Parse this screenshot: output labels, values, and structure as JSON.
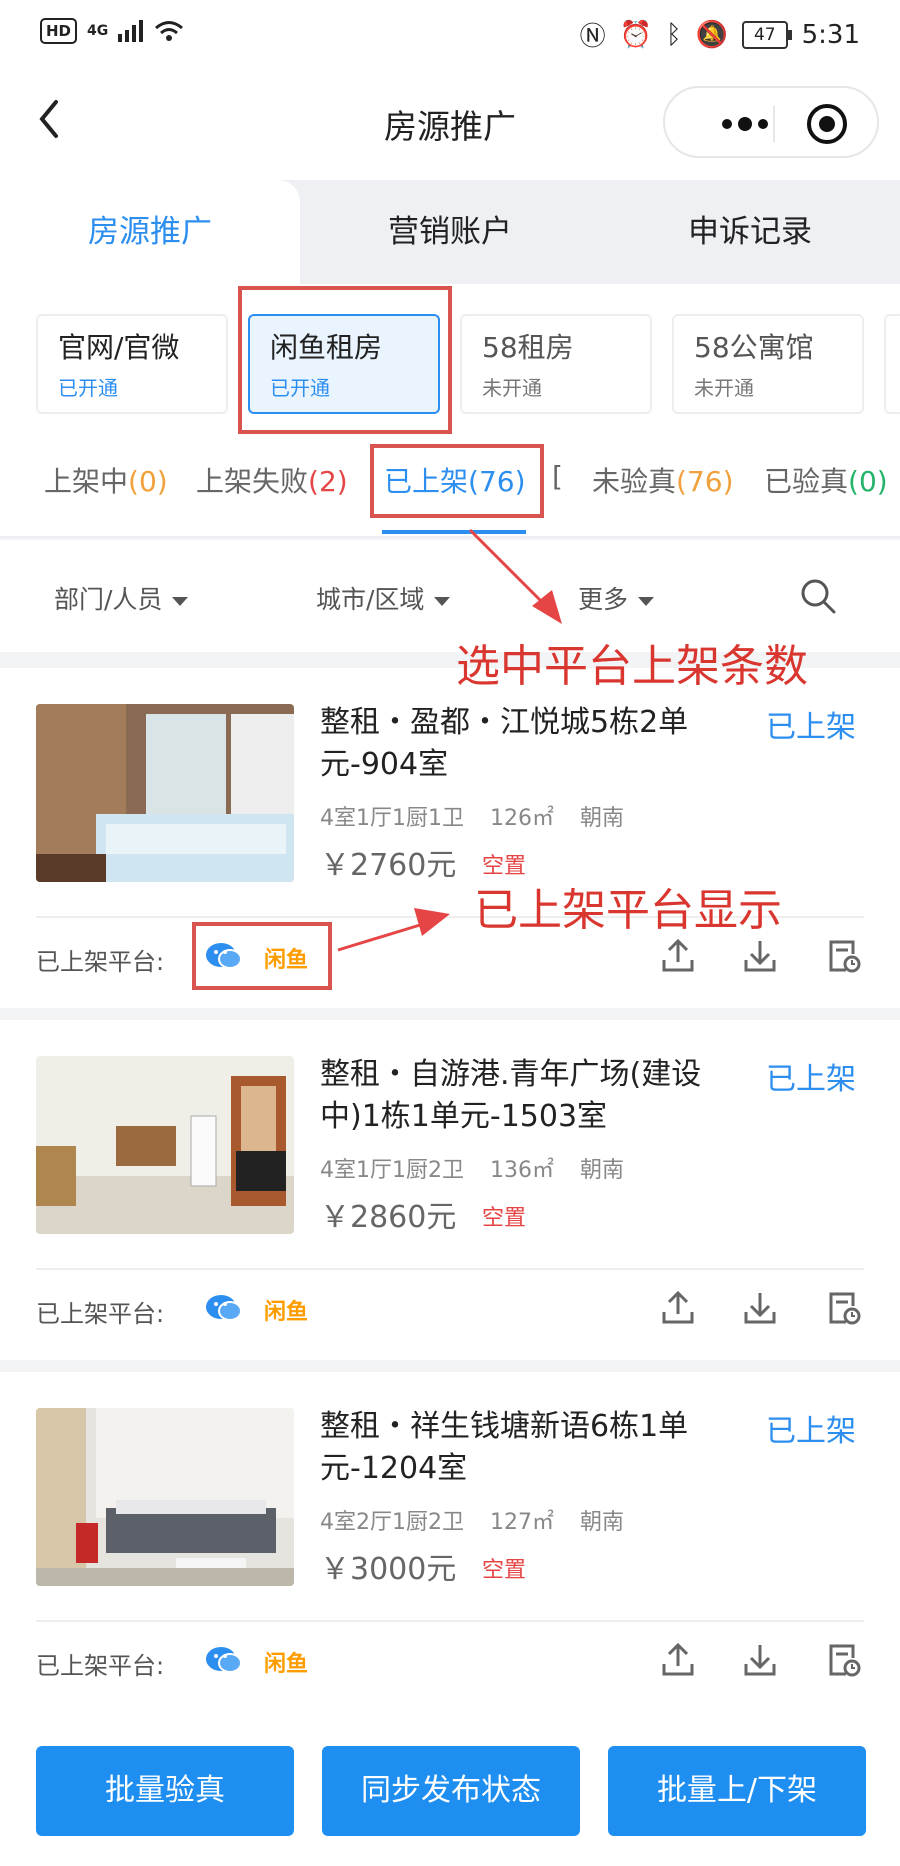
{
  "status_bar": {
    "hd": "HD",
    "network": "4G",
    "battery": "47",
    "time": "5:31"
  },
  "nav": {
    "title": "房源推广"
  },
  "top_tabs": [
    {
      "label": "房源推广",
      "active": true
    },
    {
      "label": "营销账户",
      "active": false
    },
    {
      "label": "申诉记录",
      "active": false
    }
  ],
  "platforms": [
    {
      "name": "官网/官微",
      "status": "已开通"
    },
    {
      "name": "闲鱼租房",
      "status": "已开通"
    },
    {
      "name": "58租房",
      "status": "未开通"
    },
    {
      "name": "58公寓馆",
      "status": "未开通"
    }
  ],
  "status_tabs": [
    {
      "label": "上架中",
      "count": "(0)"
    },
    {
      "label": "上架失败",
      "count": "(2)"
    },
    {
      "label": "已上架",
      "count": "(76)"
    },
    {
      "label": "[",
      "count": ""
    },
    {
      "label": "未验真",
      "count": "(76)"
    },
    {
      "label": "已验真",
      "count": "(0)"
    }
  ],
  "filters": {
    "dept": "部门/人员",
    "city": "城市/区域",
    "more": "更多"
  },
  "listings": [
    {
      "title": "整租・盈都・江悦城5栋2单元-904室",
      "status": "已上架",
      "rooms": "4室1厅1厨1卫",
      "area": "126㎡",
      "orientation": "朝南",
      "price": "￥2760元",
      "vacancy": "空置",
      "platform_label": "已上架平台:",
      "platform_logo": "闲鱼"
    },
    {
      "title": "整租・自游港.青年广场(建设中)1栋1单元-1503室",
      "status": "已上架",
      "rooms": "4室1厅1厨2卫",
      "area": "136㎡",
      "orientation": "朝南",
      "price": "￥2860元",
      "vacancy": "空置",
      "platform_label": "已上架平台:",
      "platform_logo": "闲鱼"
    },
    {
      "title": "整租・祥生钱塘新语6栋1单元-1204室",
      "status": "已上架",
      "rooms": "4室2厅1厨2卫",
      "area": "127㎡",
      "orientation": "朝南",
      "price": "￥3000元",
      "vacancy": "空置",
      "platform_label": "已上架平台:",
      "platform_logo": "闲鱼"
    }
  ],
  "bottom_buttons": {
    "verify": "批量验真",
    "sync": "同步发布状态",
    "shelf": "批量上/下架"
  },
  "annotations": {
    "count_note": "选中平台上架条数",
    "platform_note": "已上架平台显示"
  },
  "colors": {
    "accent": "#2c8ff0",
    "annotation": "#d9362f",
    "vacant": "#e64545",
    "xianyu": "#ff9c00"
  }
}
